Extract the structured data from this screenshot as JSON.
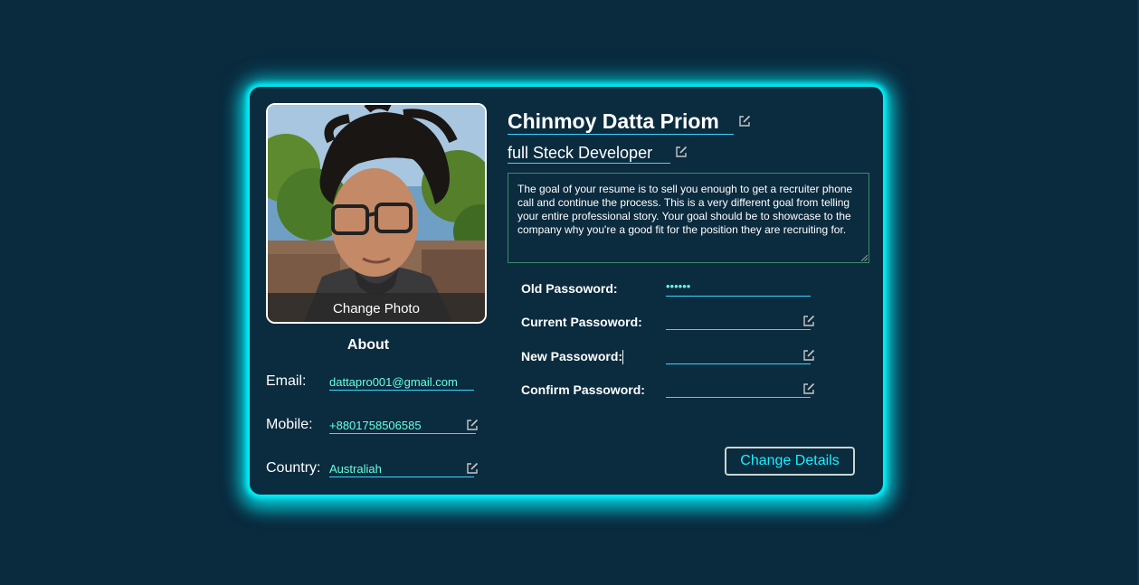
{
  "profile": {
    "name": "Chinmoy Datta Priom",
    "job_title": "full Steck Developer",
    "bio": "The goal of your resume is to sell you enough to get a recruiter phone call and continue the process. This is a very different goal from telling your entire professional story. Your goal should be to showcase to the company why you're a good fit for the position they are recruiting for.",
    "change_photo_label": "Change Photo"
  },
  "about": {
    "title": "About",
    "rows": [
      {
        "label": "Email:",
        "value": "dattapro001@gmail.com"
      },
      {
        "label": "Mobile:",
        "value": "+8801758506585"
      },
      {
        "label": "Country:",
        "value": "Australiah"
      }
    ]
  },
  "passwords": {
    "rows": [
      {
        "label": "Old Passoword:",
        "value": "••••••"
      },
      {
        "label": "Current Passoword:",
        "value": ""
      },
      {
        "label": "New Passoword:",
        "value": ""
      },
      {
        "label": "Confirm Passoword:",
        "value": ""
      }
    ]
  },
  "actions": {
    "change_details_label": "Change Details"
  },
  "icons": {
    "edit": "edit-icon"
  },
  "colors": {
    "background": "#0a2a3e",
    "card": "#0b2b3f",
    "glow": "#00f6ff",
    "accent_text": "#66ffe0",
    "underline": "#39d7ff",
    "button_text": "#1af0ff"
  }
}
